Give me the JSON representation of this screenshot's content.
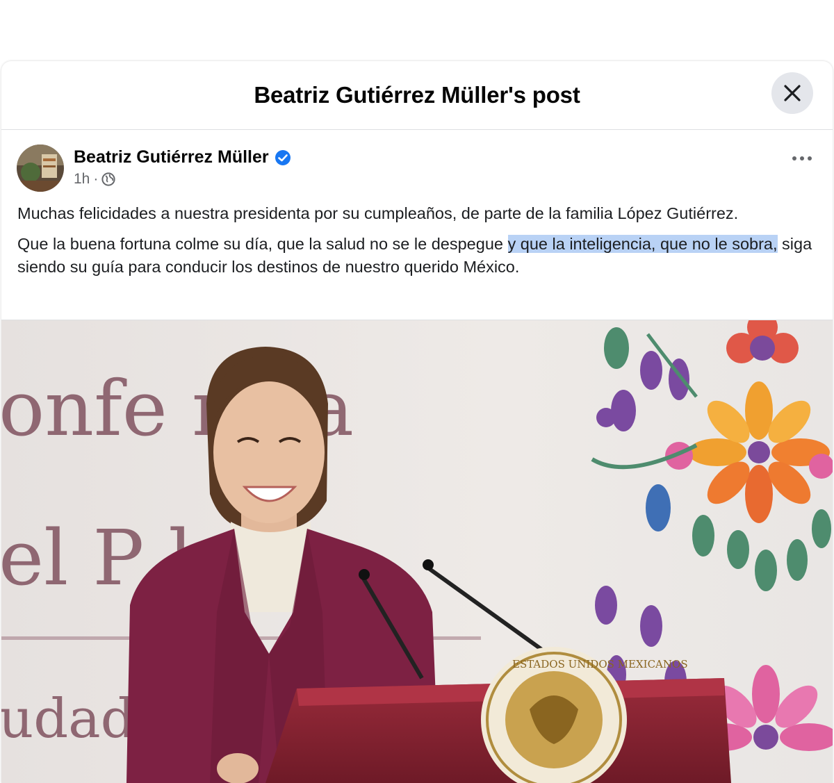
{
  "dialog": {
    "title": "Beatriz Gutiérrez Müller's post",
    "close_icon": "close-icon"
  },
  "post": {
    "author": "Beatriz Gutiérrez Müller",
    "verified_icon": "verified-badge-icon",
    "time": "1h",
    "separator": "·",
    "audience_icon": "globe-icon",
    "more_icon": "more-options-icon",
    "paragraph1": "Muchas felicidades a nuestra presidenta por su cumpleaños, de parte de la familia López Gutiérrez.",
    "paragraph2_before": "Que la buena fortuna colme su día, que la salud no se le despegue ",
    "paragraph2_highlight": "y que la inteligencia, que no le sobra,",
    "paragraph2_after": " siga siendo su guía para conducir los destinos de nuestro querido México.",
    "highlight_color": "#b9d2f5"
  },
  "photo": {
    "backdrop_text_line1": "onfe    ncia",
    "backdrop_text_line2": "el P    lo",
    "backdrop_text_line3": "udad",
    "seal_text": "ESTADOS UNIDOS MEXICANOS",
    "backdrop_text_color": "#7a4a5a",
    "podium_color": "#8a2433",
    "jacket_color": "#7d2143"
  },
  "colors": {
    "link_blue": "#1877f2",
    "secondary_text": "#65676b",
    "button_gray": "#e4e6eb"
  }
}
